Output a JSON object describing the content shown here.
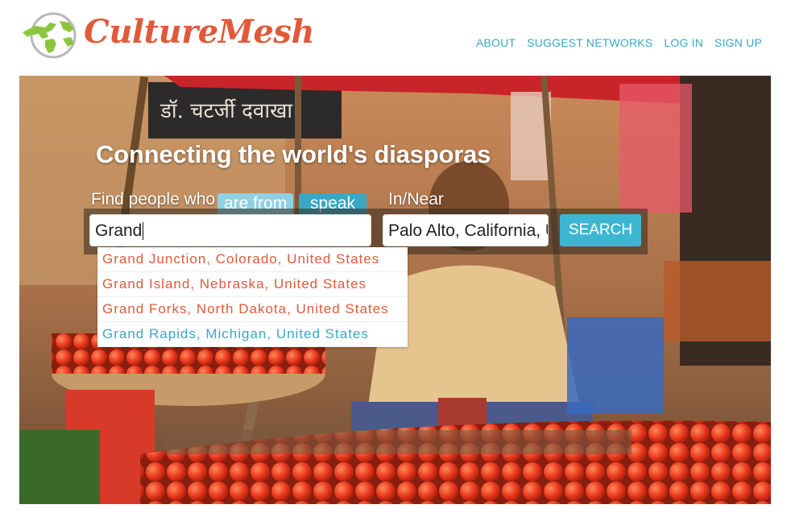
{
  "brand": {
    "name": "CultureMesh",
    "accent": "#e05a3a",
    "link_color": "#3aa7c4",
    "globe_icon": "globe-icon"
  },
  "nav": [
    "ABOUT",
    "SUGGEST NETWORKS",
    "LOG IN",
    "SIGN UP"
  ],
  "hero": {
    "headline": "Connecting the world's diasporas",
    "find_label": "Find people who",
    "tabs": [
      {
        "label": "are from",
        "state": "inactive"
      },
      {
        "label": "speak",
        "state": "active"
      }
    ],
    "near_label": "In/Near",
    "search_value": "Grand",
    "location_value": "Palo Alto, California, U",
    "search_button": "SEARCH",
    "suggestions": [
      "Grand Junction, Colorado, United States",
      "Grand Island, Nebraska, United States",
      "Grand Forks, North Dakota, United States",
      "Grand Rapids, Michigan, United States"
    ],
    "highlighted_suggestion": 3
  }
}
